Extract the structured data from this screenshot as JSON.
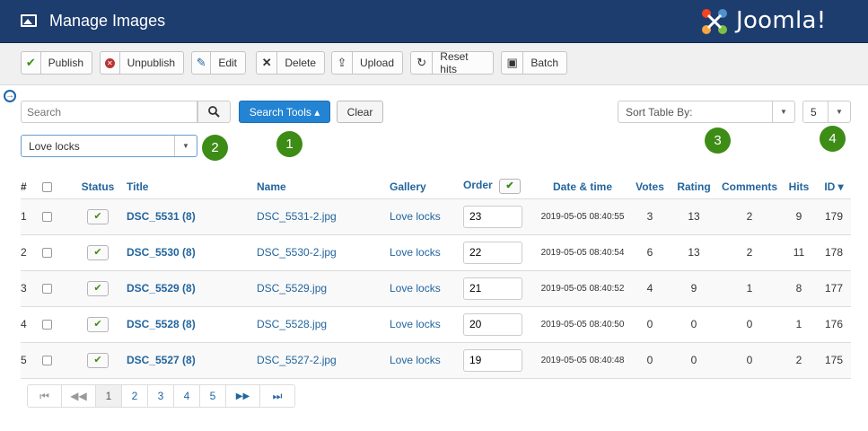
{
  "header": {
    "title": "Manage Images",
    "brand_name": "Joomla!"
  },
  "toolbar": {
    "buttons": [
      {
        "label": "Publish",
        "icon": "check-icon"
      },
      {
        "label": "Unpublish",
        "icon": "unpublish-icon"
      },
      {
        "label": "Edit",
        "icon": "edit-icon"
      },
      {
        "label": "Delete",
        "icon": "delete-icon"
      },
      {
        "label": "Upload",
        "icon": "upload-icon"
      },
      {
        "label": "Reset hits",
        "icon": "refresh-icon"
      },
      {
        "label": "Batch",
        "icon": "batch-icon"
      }
    ]
  },
  "filters": {
    "search_placeholder": "Search",
    "search_tools_label": "Search Tools ▴",
    "clear_label": "Clear",
    "gallery_value": "Love locks",
    "sort_value": "Sort Table By:",
    "limit_value": "5"
  },
  "badges": [
    "1",
    "2",
    "3",
    "4"
  ],
  "table": {
    "columns": [
      "#",
      "Status",
      "Title",
      "Name",
      "Gallery",
      "Order",
      "Date & time",
      "Votes",
      "Rating",
      "Comments",
      "Hits",
      "ID ▾"
    ],
    "rows": [
      {
        "num": "1",
        "title": "DSC_5531 (8)",
        "name": "DSC_5531-2.jpg",
        "gallery": "Love locks",
        "order": "23",
        "date": "2019-05-05 08:40:55",
        "votes": "3",
        "rating": "13",
        "comments": "2",
        "hits": "9",
        "id": "179"
      },
      {
        "num": "2",
        "title": "DSC_5530 (8)",
        "name": "DSC_5530-2.jpg",
        "gallery": "Love locks",
        "order": "22",
        "date": "2019-05-05 08:40:54",
        "votes": "6",
        "rating": "13",
        "comments": "2",
        "hits": "11",
        "id": "178"
      },
      {
        "num": "3",
        "title": "DSC_5529 (8)",
        "name": "DSC_5529.jpg",
        "gallery": "Love locks",
        "order": "21",
        "date": "2019-05-05 08:40:52",
        "votes": "4",
        "rating": "9",
        "comments": "1",
        "hits": "8",
        "id": "177"
      },
      {
        "num": "4",
        "title": "DSC_5528 (8)",
        "name": "DSC_5528.jpg",
        "gallery": "Love locks",
        "order": "20",
        "date": "2019-05-05 08:40:50",
        "votes": "0",
        "rating": "0",
        "comments": "0",
        "hits": "1",
        "id": "176"
      },
      {
        "num": "5",
        "title": "DSC_5527 (8)",
        "name": "DSC_5527-2.jpg",
        "gallery": "Love locks",
        "order": "19",
        "date": "2019-05-05 08:40:48",
        "votes": "0",
        "rating": "0",
        "comments": "0",
        "hits": "2",
        "id": "175"
      }
    ]
  },
  "pagination": {
    "pages": [
      "1",
      "2",
      "3",
      "4",
      "5"
    ],
    "current": "1"
  }
}
